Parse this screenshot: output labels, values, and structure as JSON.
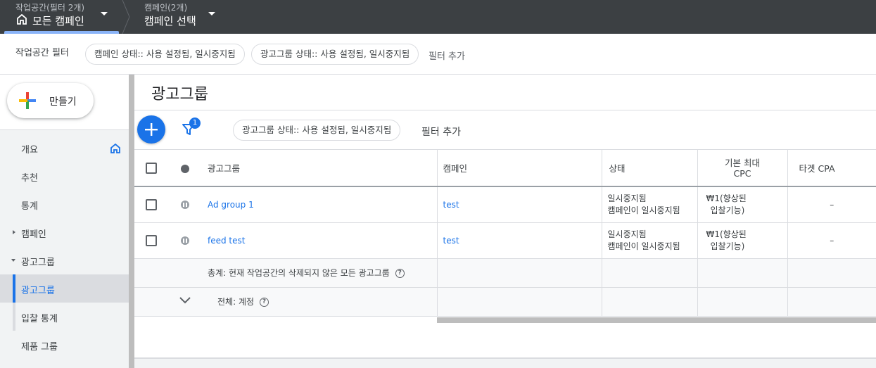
{
  "topbar": {
    "workspace_small": "작업공간(필터 2개)",
    "workspace_big": "모든 캠페인",
    "campaign_small": "캠페인(2개)",
    "campaign_big": "캠페인 선택"
  },
  "workspace_filter": {
    "label": "작업공간 필터",
    "chips": [
      "캠페인 상태:: 사용 설정됨, 일시중지됨",
      "광고그룹 상태:: 사용 설정됨, 일시중지됨"
    ],
    "add_filter": "필터 추가"
  },
  "sidebar": {
    "create_label": "만들기",
    "items": [
      {
        "label": "개요"
      },
      {
        "label": "추천"
      },
      {
        "label": "통계"
      },
      {
        "label": "캠페인"
      },
      {
        "label": "광고그룹"
      },
      {
        "label": "광고그룹"
      },
      {
        "label": "입찰 통계"
      },
      {
        "label": "제품 그룹"
      }
    ]
  },
  "main": {
    "title": "광고그룹",
    "filter_badge": "1",
    "filter_chip": "광고그룹 상태:: 사용 설정됨, 일시중지됨",
    "add_filter": "필터 추가",
    "columns": {
      "adgroup": "광고그룹",
      "campaign": "캠페인",
      "status": "상태",
      "cpc_line1": "기본 최대",
      "cpc_line2": "CPC",
      "target_cpa": "타겟 CPA"
    },
    "rows": [
      {
        "adgroup": "Ad group 1",
        "campaign": "test",
        "status1": "일시중지됨",
        "status2": "캠페인이 일시중지됨",
        "cpc1": "₩1(향상된",
        "cpc2": "입찰기능)",
        "cpa": "–"
      },
      {
        "adgroup": "feed test",
        "campaign": "test",
        "status1": "일시중지됨",
        "status2": "캠페인이 일시중지됨",
        "cpc1": "₩1(향상된",
        "cpc2": "입찰기능)",
        "cpa": "–"
      }
    ],
    "summary_workspace": "총계: 현재 작업공간의 삭제되지 않은 모든 광고그룹",
    "summary_account": "전체: 계정",
    "help_glyph": "?"
  }
}
